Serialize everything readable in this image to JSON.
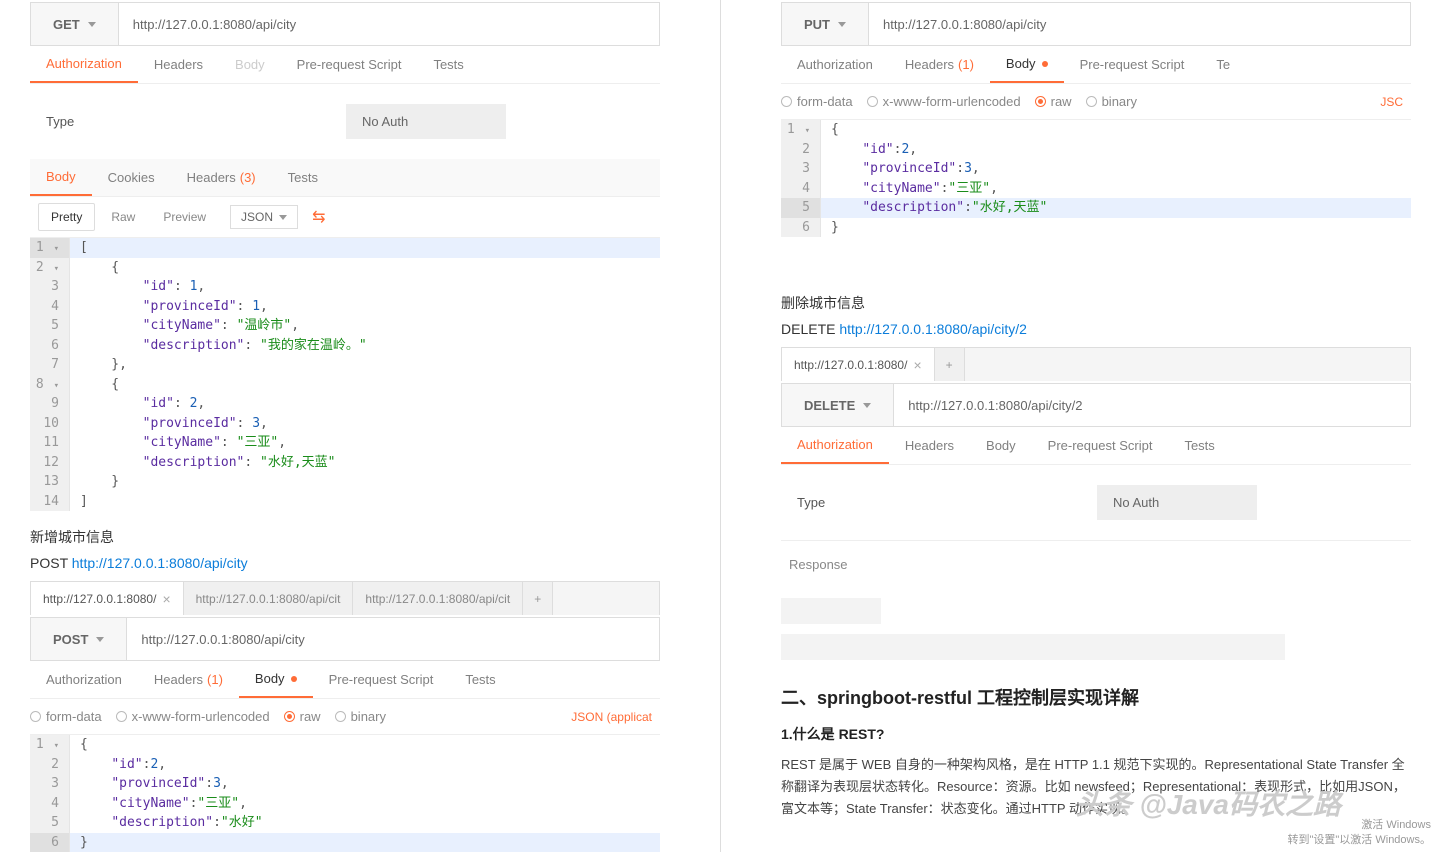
{
  "left": {
    "get": {
      "method": "GET",
      "url": "http://127.0.0.1:8080/api/city",
      "tabs": {
        "authorization": "Authorization",
        "headers": "Headers",
        "body": "Body",
        "prereq": "Pre-request Script",
        "tests": "Tests"
      },
      "auth": {
        "type_label": "Type",
        "no_auth": "No Auth"
      },
      "resp_tabs": {
        "body": "Body",
        "cookies": "Cookies",
        "headers": "Headers",
        "headers_count": "(3)",
        "tests": "Tests"
      },
      "view": {
        "pretty": "Pretty",
        "raw": "Raw",
        "preview": "Preview",
        "json": "JSON"
      },
      "code": {
        "l1": "[",
        "l2": "    {",
        "l3_k": "\"id\"",
        "l3_v": "1",
        "l4_k": "\"provinceId\"",
        "l4_v": "1",
        "l5_k": "\"cityName\"",
        "l5_v": "\"温岭市\"",
        "l6_k": "\"description\"",
        "l6_v": "\"我的家在温岭。\"",
        "l7": "    },",
        "l8": "    {",
        "l9_k": "\"id\"",
        "l9_v": "2",
        "l10_k": "\"provinceId\"",
        "l10_v": "3",
        "l11_k": "\"cityName\"",
        "l11_v": "\"三亚\"",
        "l12_k": "\"description\"",
        "l12_v": "\"水好,天蓝\"",
        "l13": "    }",
        "l14": "]"
      }
    },
    "post": {
      "heading": "新增城市信息",
      "verb": "POST",
      "link": "http://127.0.0.1:8080/api/city",
      "req_tabs": [
        "http://127.0.0.1:8080/",
        "http://127.0.0.1:8080/api/cit",
        "http://127.0.0.1:8080/api/cit"
      ],
      "add": "+",
      "method": "POST",
      "url": "http://127.0.0.1:8080/api/city",
      "tabs": {
        "authorization": "Authorization",
        "headers": "Headers",
        "headers_count": "(1)",
        "body": "Body",
        "prereq": "Pre-request Script",
        "tests": "Tests"
      },
      "body_types": {
        "formdata": "form-data",
        "urlenc": "x-www-form-urlencoded",
        "raw": "raw",
        "binary": "binary",
        "json": "JSON (applicat"
      },
      "code": {
        "l1": "{",
        "l2_k": "\"id\"",
        "l2_v": "2",
        "l3_k": "\"provinceId\"",
        "l3_v": "3",
        "l4_k": "\"cityName\"",
        "l4_v": "\"三亚\"",
        "l5_k": "\"description\"",
        "l5_v": "\"水好\"",
        "l6": "}"
      }
    }
  },
  "right": {
    "put": {
      "method": "PUT",
      "url": "http://127.0.0.1:8080/api/city",
      "tabs": {
        "authorization": "Authorization",
        "headers": "Headers",
        "headers_count": "(1)",
        "body": "Body",
        "prereq": "Pre-request Script",
        "tests": "Te"
      },
      "body_types": {
        "formdata": "form-data",
        "urlenc": "x-www-form-urlencoded",
        "raw": "raw",
        "binary": "binary",
        "json": "JSC"
      },
      "code": {
        "l1": "{",
        "l2_k": "\"id\"",
        "l2_v": "2",
        "l3_k": "\"provinceId\"",
        "l3_v": "3",
        "l4_k": "\"cityName\"",
        "l4_v": "\"三亚\"",
        "l5_k": "\"description\"",
        "l5_v": "\"水好,天蓝\"",
        "l6": "}"
      }
    },
    "delete": {
      "heading": "删除城市信息",
      "verb": "DELETE",
      "link": "http://127.0.0.1:8080/api/city/2",
      "req_tab": "http://127.0.0.1:8080/",
      "add": "+",
      "method": "DELETE",
      "url": "http://127.0.0.1:8080/api/city/2",
      "tabs": {
        "authorization": "Authorization",
        "headers": "Headers",
        "body": "Body",
        "prereq": "Pre-request Script",
        "tests": "Tests"
      },
      "auth": {
        "type_label": "Type",
        "no_auth": "No Auth"
      },
      "response": "Response"
    },
    "article": {
      "h2": "二、springboot-restful 工程控制层实现详解",
      "sub": "1.什么是 REST?",
      "p1": "REST 是属于 WEB 自身的一种架构风格，是在 HTTP 1.1 规范下实现的。Representational State Transfer 全称翻译为表现层状态转化。Resource：资源。比如 newsfeed；Representational：表现形式，比如用JSON，富文本等；State Transfer：状态变化。通过HTTP 动作实现。"
    }
  },
  "watermark": "头条 @Java码农之路",
  "winmark1": "激活 Windows",
  "winmark2": "转到\"设置\"以激活 Windows。"
}
